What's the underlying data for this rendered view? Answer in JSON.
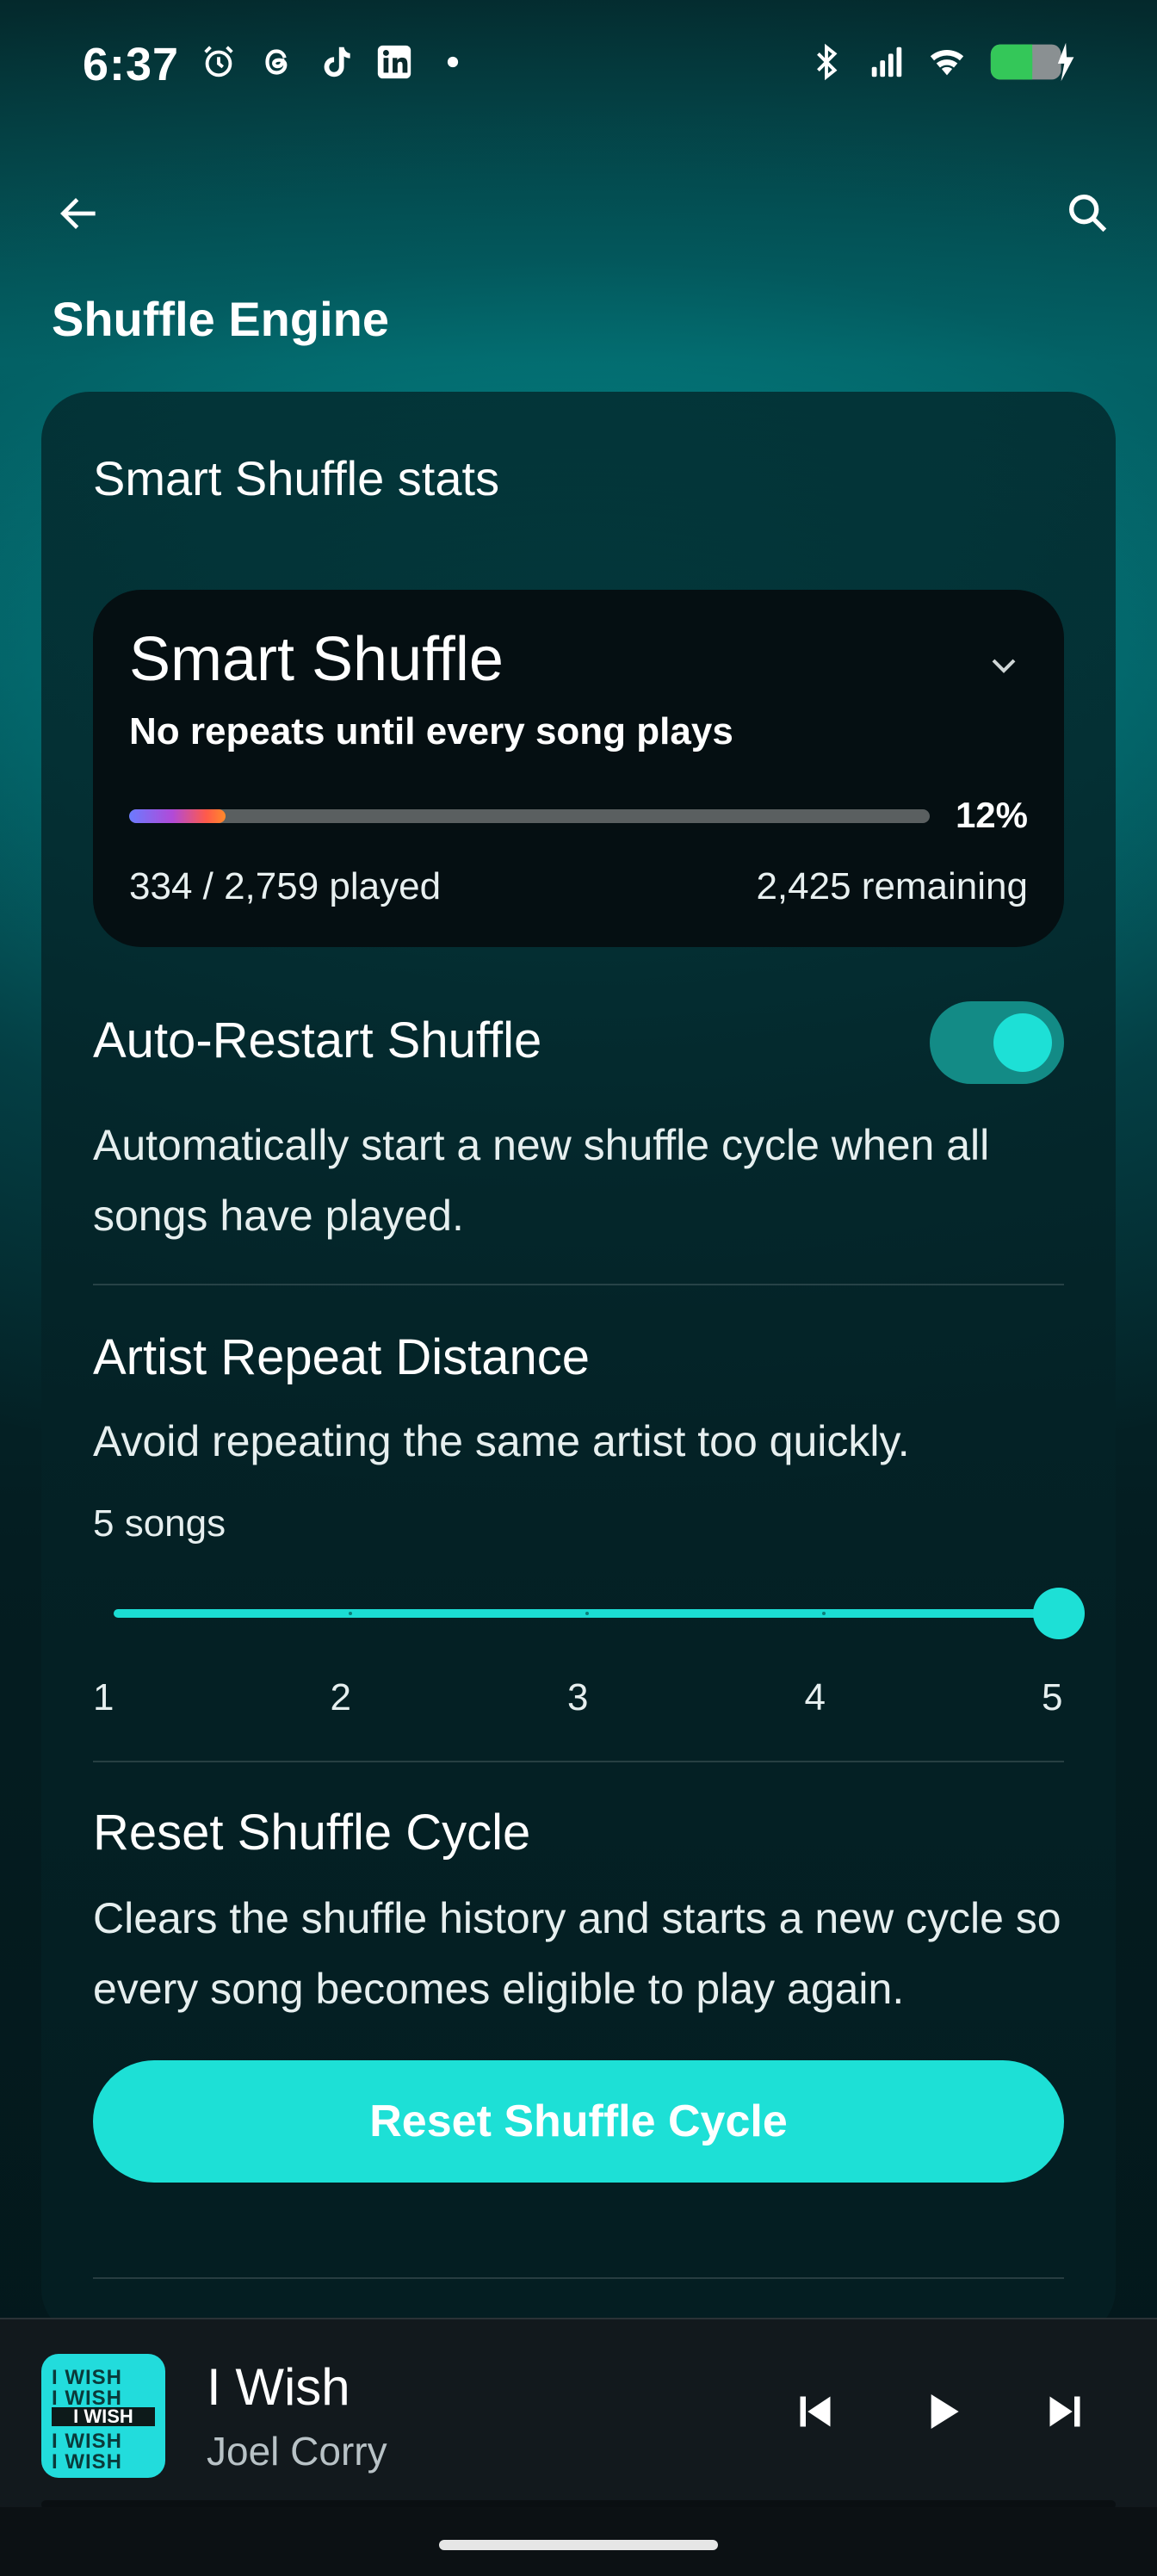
{
  "status_bar": {
    "time": "6:37",
    "left_icons": [
      "alarm-icon",
      "threads-icon",
      "tiktok-icon",
      "linkedin-icon",
      "dot-icon"
    ],
    "right_icons": [
      "bluetooth-icon",
      "signal-icon",
      "wifi-icon",
      "battery-charging-icon"
    ],
    "battery_color": "#34c759"
  },
  "header": {
    "title": "Shuffle Engine",
    "back_icon": "arrow-left-icon",
    "search_icon": "search-icon"
  },
  "card": {
    "title": "Smart Shuffle stats",
    "smart_shuffle": {
      "mode": "Smart Shuffle",
      "subtitle": "No repeats until every song plays",
      "progress_percent": "12%",
      "progress_fraction": 0.12,
      "played": "334 / 2,759 played",
      "remaining": "2,425 remaining"
    },
    "auto_restart": {
      "title": "Auto-Restart Shuffle",
      "description": "Automatically start a new shuffle cycle when all songs have played.",
      "enabled": true
    },
    "artist_repeat": {
      "title": "Artist Repeat Distance",
      "description": "Avoid repeating the same artist too quickly.",
      "value_label": "5 songs",
      "value": 5,
      "min": 1,
      "max": 5,
      "ticks": [
        "1",
        "2",
        "3",
        "4",
        "5"
      ]
    },
    "reset": {
      "title": "Reset Shuffle Cycle",
      "description": "Clears the shuffle history and starts a new cycle so every song becomes eligible to play again.",
      "button_label": "Reset Shuffle Cycle"
    }
  },
  "mini_player": {
    "track_title": "I Wish",
    "artist": "Joel Corry",
    "art_text": "I WISH",
    "controls": [
      "skip-previous-icon",
      "play-icon",
      "skip-next-icon"
    ]
  },
  "colors": {
    "accent": "#1de0d6",
    "toggle_track": "#138b86",
    "panel": "#050f12"
  }
}
